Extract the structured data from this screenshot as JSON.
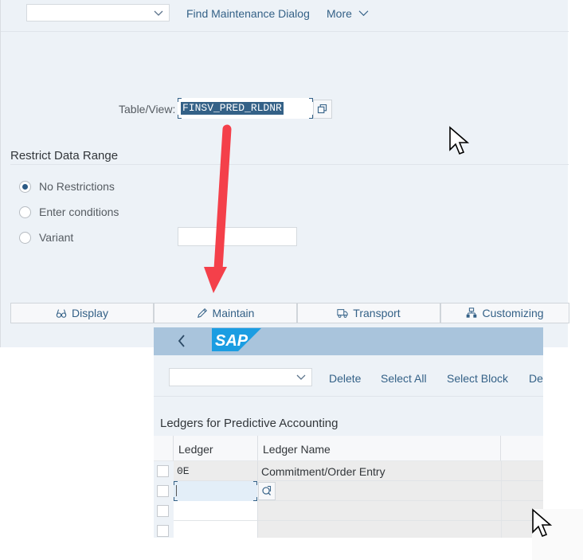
{
  "screen1": {
    "toolbar": {
      "combo_value": "",
      "links": [
        "Find Maintenance Dialog",
        "More"
      ]
    },
    "table_view": {
      "label": "Table/View:",
      "value": "FINSV_PRED_RLDNR"
    },
    "restrict": {
      "title": "Restrict Data Range",
      "options": [
        {
          "label": "No Restrictions",
          "selected": true
        },
        {
          "label": "Enter conditions",
          "selected": false
        },
        {
          "label": "Variant",
          "selected": false
        }
      ],
      "variant_value": ""
    },
    "actions": [
      {
        "label": "Display",
        "icon": "glasses-icon"
      },
      {
        "label": "Maintain",
        "icon": "pencil-icon"
      },
      {
        "label": "Transport",
        "icon": "truck-icon"
      },
      {
        "label": "Customizing",
        "icon": "hierarchy-icon"
      }
    ]
  },
  "screen2": {
    "shell": {
      "logo": "SAP"
    },
    "toolbar": {
      "combo_value": "",
      "buttons": [
        "Delete",
        "Select All",
        "Select Block",
        "De"
      ]
    },
    "table": {
      "title": "Ledgers for Predictive Accounting",
      "columns": [
        "Ledger",
        "Ledger Name"
      ],
      "rows": [
        {
          "ledger": "0E",
          "name": "Commitment/Order Entry"
        },
        {
          "ledger": "",
          "name": ""
        },
        {
          "ledger": "",
          "name": ""
        },
        {
          "ledger": "",
          "name": ""
        }
      ]
    }
  },
  "annotation": {
    "arrow_color": "#f4404a"
  }
}
